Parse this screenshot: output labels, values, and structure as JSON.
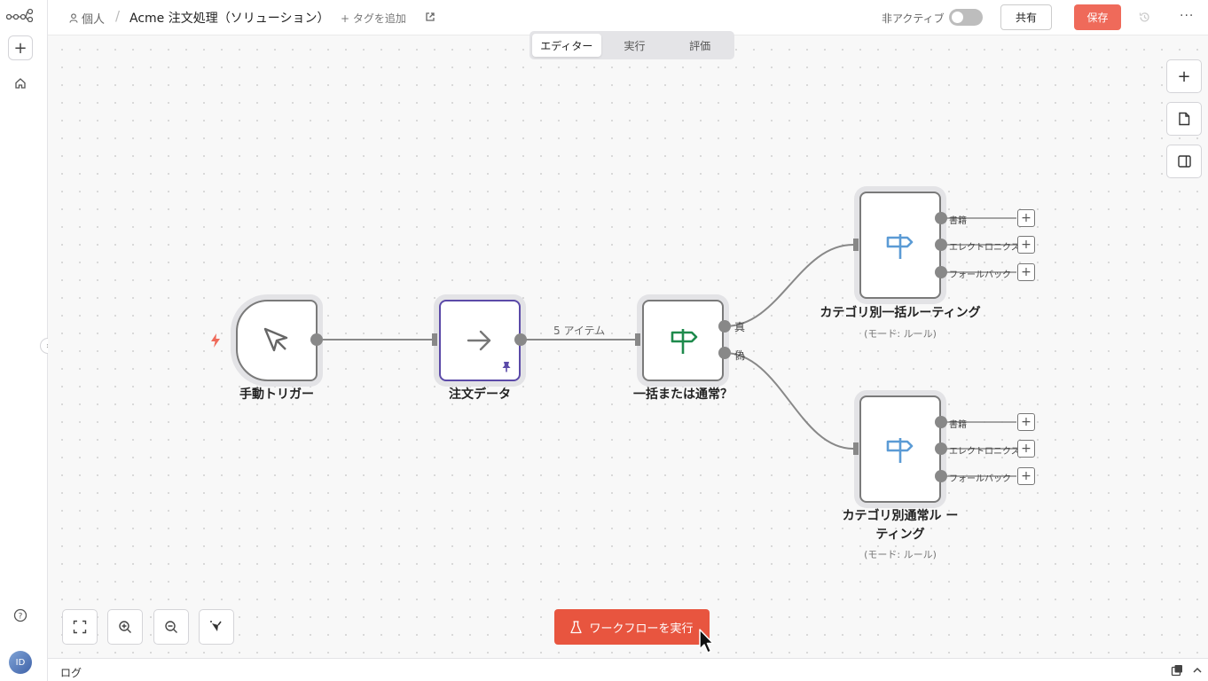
{
  "header": {
    "breadcrumb_user": "個人",
    "breadcrumb_sep": "/",
    "workflow_title": "Acme 注文処理（ソリューション）",
    "add_tag": "+ タグを追加",
    "inactive_label": "非アクティブ",
    "share_label": "共有",
    "save_label": "保存",
    "more_label": "···"
  },
  "tabs": [
    {
      "label": "エディター",
      "active": true
    },
    {
      "label": "実行",
      "active": false
    },
    {
      "label": "評価",
      "active": false
    }
  ],
  "nodes": {
    "trigger": {
      "label": "手動トリガー"
    },
    "order_data": {
      "label": "注文データ"
    },
    "bulk_or_normal": {
      "label": "一括または通常？",
      "out_true": "真",
      "out_false": "偽"
    },
    "bulk_routing": {
      "label": "カテゴリ別一括ルーティング",
      "sub": "(モード: ルール)",
      "outputs": [
        "書籍",
        "エレクトロニクス",
        "フォールバック"
      ]
    },
    "normal_routing": {
      "label_line1": "カテゴリ別通常ル ー",
      "label_line2": "ティング",
      "sub": "(モード: ルール)",
      "outputs": [
        "書籍",
        "エレクトロニクス",
        "フォールバック"
      ]
    }
  },
  "edge_label": "5 アイテム",
  "run_button": "ワークフローを実行",
  "log": {
    "label": "ログ"
  },
  "avatar_initials": "ID",
  "colors": {
    "accent": "#e8553f",
    "save": "#ef6a5a",
    "router_icon": "#5b9bd5",
    "if_icon": "#1e8a4c",
    "pin": "#5b4aa8"
  }
}
